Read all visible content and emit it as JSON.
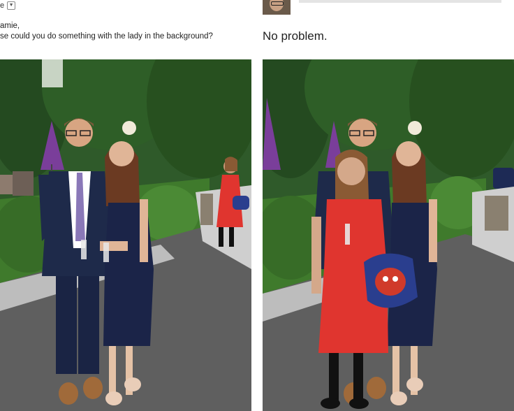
{
  "left_header": {
    "name_fragment": "e",
    "greeting": "amie,",
    "request": "se could you do something with the lady in the background?"
  },
  "right_header": {
    "reply": "No problem."
  },
  "photos": {
    "left": {
      "description_icon": "photo-original"
    },
    "right": {
      "description_icon": "photo-edited"
    }
  },
  "colors": {
    "red_dress": "#e0352f",
    "navy": "#1e2a4a",
    "hedge": "#3f7a2c",
    "umbrella": "#7a3e9a"
  }
}
